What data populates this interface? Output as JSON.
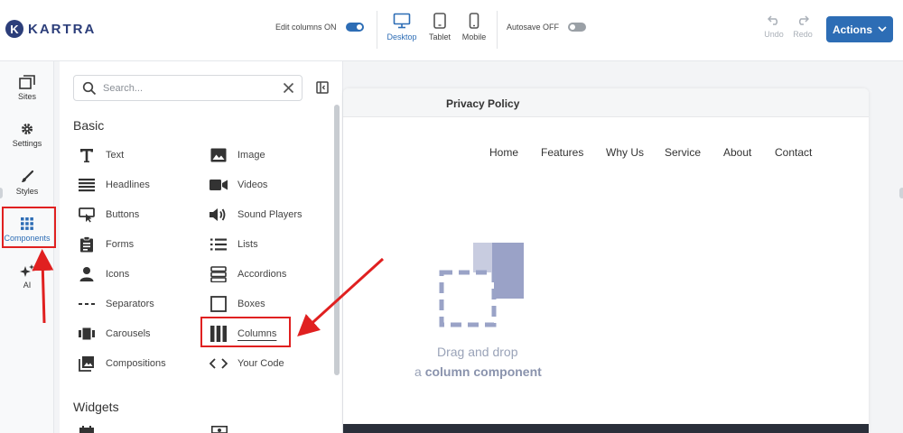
{
  "app": {
    "logo_letter": "K",
    "logo_text": "KARTRA"
  },
  "toolbar": {
    "edit_columns_label": "Edit columns ON",
    "devices": [
      {
        "label": "Desktop",
        "icon": "monitor-icon",
        "active": true
      },
      {
        "label": "Tablet",
        "icon": "tablet-icon",
        "active": false
      },
      {
        "label": "Mobile",
        "icon": "mobile-icon",
        "active": false
      }
    ],
    "autosave_label": "Autosave OFF",
    "undo_label": "Undo",
    "redo_label": "Redo",
    "actions_label": "Actions"
  },
  "rail": {
    "items": [
      {
        "label": "Sites",
        "icon": "sites-icon"
      },
      {
        "label": "Settings",
        "icon": "gear-icon"
      },
      {
        "label": "Styles",
        "icon": "brush-icon"
      },
      {
        "label": "Components",
        "icon": "grid-icon",
        "active": true
      },
      {
        "label": "AI",
        "icon": "sparkle-icon"
      }
    ]
  },
  "panel": {
    "search_placeholder": "Search...",
    "basic_title": "Basic",
    "widgets_title": "Widgets",
    "basic_left": [
      {
        "label": "Text",
        "icon": "text-icon"
      },
      {
        "label": "Headlines",
        "icon": "headlines-icon"
      },
      {
        "label": "Buttons",
        "icon": "button-icon"
      },
      {
        "label": "Forms",
        "icon": "form-icon"
      },
      {
        "label": "Icons",
        "icon": "person-icon"
      },
      {
        "label": "Separators",
        "icon": "separator-icon"
      },
      {
        "label": "Carousels",
        "icon": "carousel-icon"
      },
      {
        "label": "Compositions",
        "icon": "compositions-icon"
      }
    ],
    "basic_right": [
      {
        "label": "Image",
        "icon": "image-icon"
      },
      {
        "label": "Videos",
        "icon": "video-icon"
      },
      {
        "label": "Sound Players",
        "icon": "speaker-icon"
      },
      {
        "label": "Lists",
        "icon": "list-icon"
      },
      {
        "label": "Accordions",
        "icon": "accordion-icon"
      },
      {
        "label": "Boxes",
        "icon": "box-icon"
      },
      {
        "label": "Columns",
        "icon": "columns-icon",
        "highlighted": true
      },
      {
        "label": "Your Code",
        "icon": "code-icon"
      }
    ]
  },
  "canvas": {
    "page_title": "Privacy Policy",
    "nav": [
      "Home",
      "Features",
      "Why Us",
      "Service",
      "About",
      "Contact"
    ],
    "dnd_line1": "Drag and drop",
    "dnd_line2_prefix": "a",
    "dnd_line2_bold": "column component"
  },
  "colors": {
    "accent": "#2d6db5",
    "annotation": "#e02020",
    "placeholder_graphic": "#9aa3c7"
  }
}
